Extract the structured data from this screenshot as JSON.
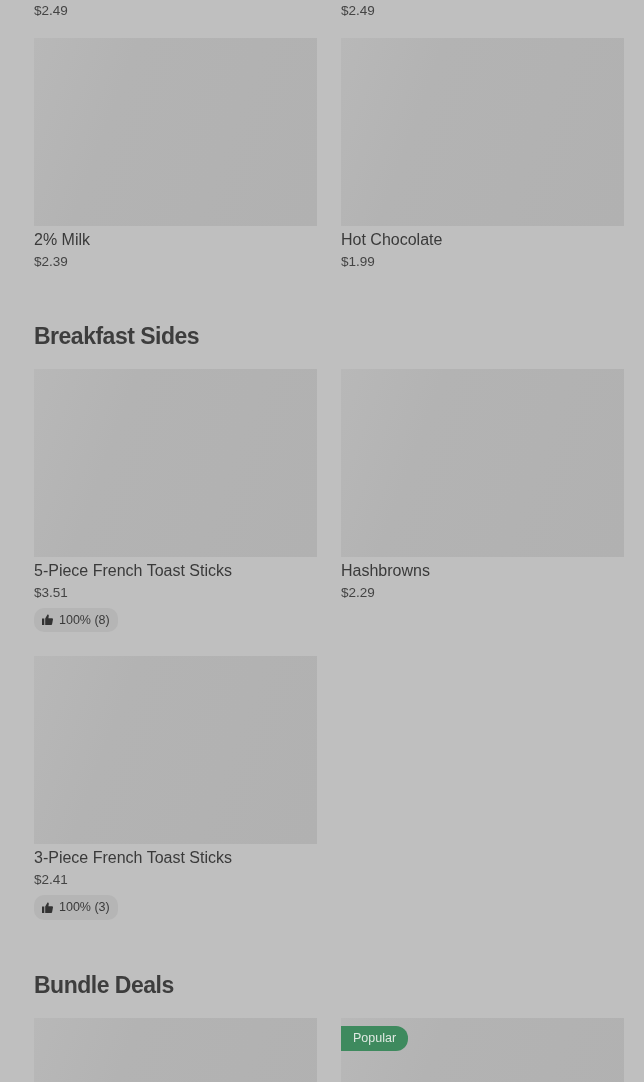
{
  "sections": [
    {
      "items": [
        {
          "price": "$2.49"
        },
        {
          "price": "$2.49"
        },
        {
          "name": "2% Milk",
          "price": "$2.39"
        },
        {
          "name": "Hot Chocolate",
          "price": "$1.99"
        }
      ]
    },
    {
      "title": "Breakfast Sides",
      "items": [
        {
          "name": "5-Piece French Toast Sticks",
          "price": "$3.51",
          "rating": "100% (8)"
        },
        {
          "name": "Hashbrowns",
          "price": "$2.29"
        },
        {
          "name": "3-Piece French Toast Sticks",
          "price": "$2.41",
          "rating": "100% (3)"
        }
      ]
    },
    {
      "title": "Bundle Deals",
      "items": [
        {
          "kind": "picture"
        },
        {
          "kind": "picture",
          "badge": "Popular"
        }
      ]
    }
  ]
}
